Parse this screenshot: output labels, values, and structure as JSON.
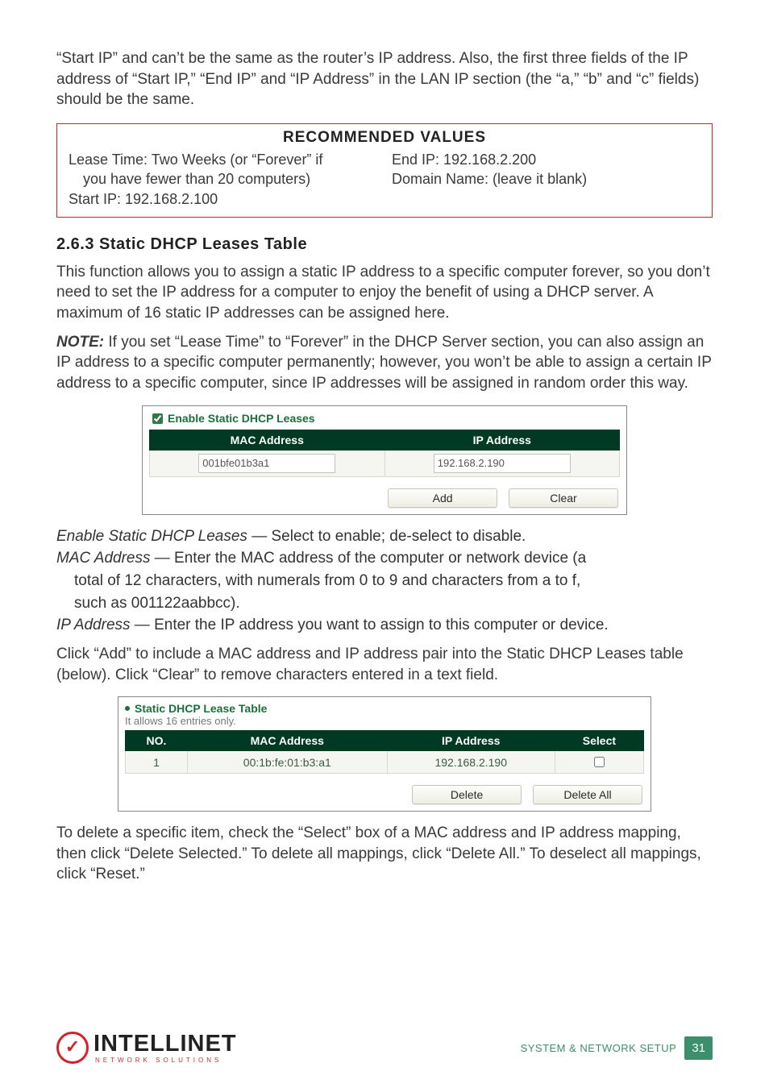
{
  "intro_p1": "“Start IP” and can’t be the same as the router’s IP address. Also, the first three fields of the IP address of “Start IP,” “End IP” and “IP Address” in the LAN IP section (the “a,” “b” and “c” fields) should be the same.",
  "recommended": {
    "title": "RECOMMENDED VALUES",
    "left_line1": "Lease Time: Two Weeks (or “Forever” if",
    "left_line1_indent": "you have fewer than 20 computers)",
    "left_line2": "Start IP: 192.168.2.100",
    "right_line1": "End IP: 192.168.2.200",
    "right_line2": "Domain Name: (leave it blank)"
  },
  "subheading": "2.6.3  Static DHCP Leases Table",
  "para1": "This function allows you to assign a static IP address to a specific computer forever, so you don’t need to set the IP address for a computer to enjoy the benefit of using a DHCP server. A maximum of 16 static IP addresses can be assigned here.",
  "note_label": "NOTE:",
  "para2": " If you set “Lease Time” to “Forever” in the DHCP Server section, you can also assign an IP address to a specific computer permanently; however, you won’t be able to assign a certain IP address to a specific computer, since IP addresses will be assigned in random order this way.",
  "fig1": {
    "checkbox_label": "Enable Static DHCP Leases",
    "col_mac": "MAC Address",
    "col_ip": "IP Address",
    "input_mac": "001bfe01b3a1",
    "input_ip": "192.168.2.190",
    "btn_add": "Add",
    "btn_clear": "Clear"
  },
  "defs": {
    "d1_term": "Enable Static DHCP Leases",
    "d1_rest": " — Select to enable; de-select to disable.",
    "d2_term": "MAC Address",
    "d2_rest": " — Enter the MAC address of the computer or network device (a",
    "d2_cont1": "total of 12 characters, with numerals from 0 to 9 and characters from a to f,",
    "d2_cont2": "such as 001122aabbcc).",
    "d3_term": "IP Address",
    "d3_rest": " — Enter the IP address you want to assign to this computer or device."
  },
  "para3": "Click “Add” to include a MAC address and IP address pair into the Static DHCP Leases table (below). Click “Clear” to remove characters entered in a text field.",
  "fig2": {
    "title": "Static DHCP Lease Table",
    "subtitle": "It allows 16 entries only.",
    "col_no": "NO.",
    "col_mac": "MAC Address",
    "col_ip": "IP Address",
    "col_select": "Select",
    "row_no": "1",
    "row_mac": "00:1b:fe:01:b3:a1",
    "row_ip": "192.168.2.190",
    "btn_delete": "Delete",
    "btn_delete_all": "Delete All"
  },
  "para4": "To delete a specific item, check the “Select” box of a MAC address and IP address mapping, then click “Delete Selected.” To delete all mappings, click “Delete All.” To deselect all mappings, click “Reset.”",
  "footer": {
    "logo_main": "INTELLINET",
    "logo_sub": "NETWORK   SOLUTIONS",
    "section": "SYSTEM & NETWORK SETUP",
    "page": "31"
  }
}
